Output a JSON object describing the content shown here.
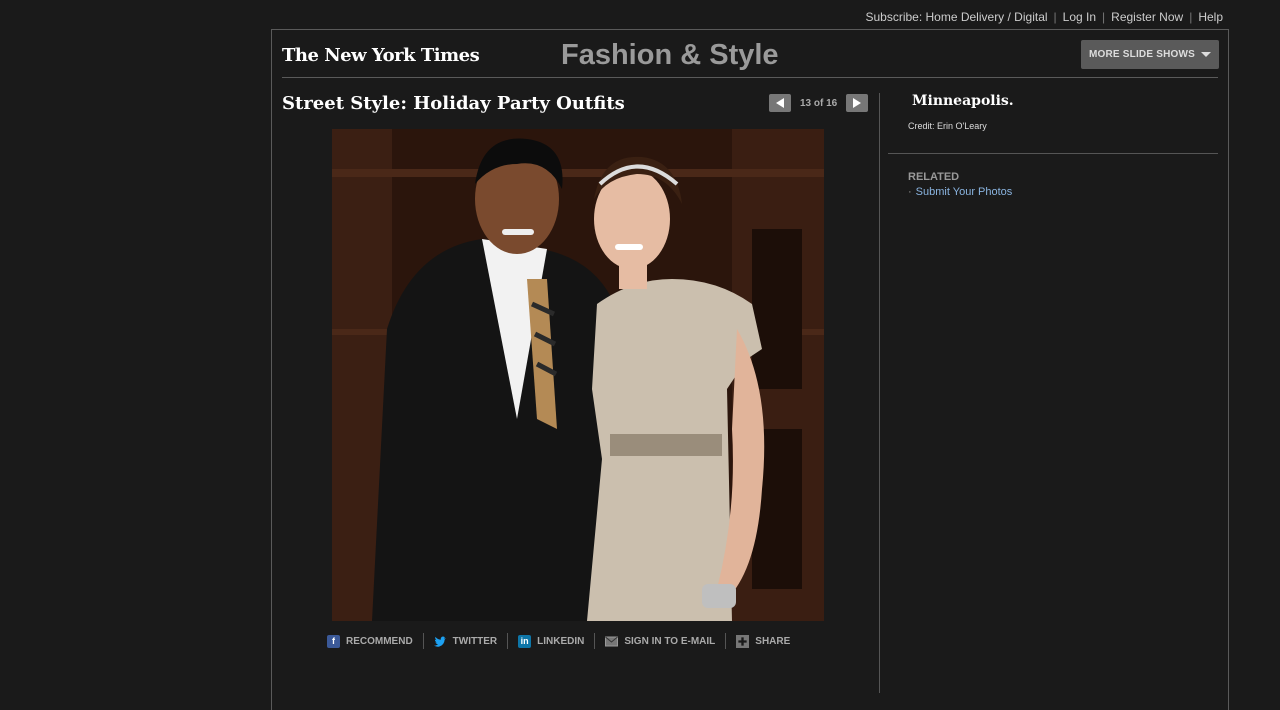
{
  "topnav": {
    "subscribe": "Subscribe: Home Delivery / Digital",
    "login": "Log In",
    "register": "Register Now",
    "help": "Help"
  },
  "header": {
    "logo": "The New York Times",
    "section": "Fashion & Style",
    "more_button": "MORE SLIDE SHOWS"
  },
  "slideshow": {
    "title": "Street Style: Holiday Party Outfits",
    "counter": "13 of 16"
  },
  "share": {
    "recommend": "RECOMMEND",
    "twitter": "TWITTER",
    "linkedin": "LINKEDIN",
    "email": "SIGN IN TO E-MAIL",
    "share": "SHARE"
  },
  "caption": {
    "place": "Minneapolis.",
    "credit": "Credit: Erin O'Leary"
  },
  "related": {
    "heading": "RELATED",
    "link": "Submit Your Photos"
  },
  "colors": {
    "background": "#1a1a1a",
    "link": "#8ab4e0",
    "section_title": "#9a9a9a"
  }
}
